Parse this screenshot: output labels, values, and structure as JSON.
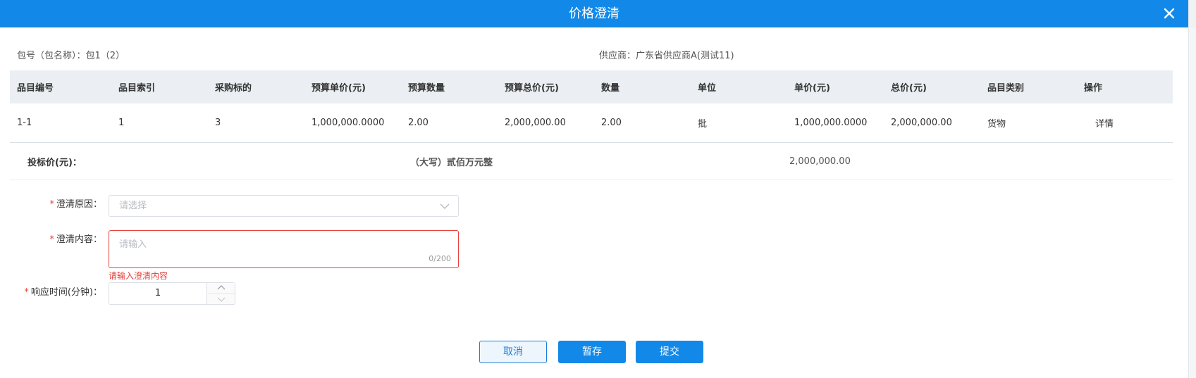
{
  "dialog": {
    "title": "价格澄清"
  },
  "package_info": {
    "label": "包号（包名称）：",
    "value": "包1（2）"
  },
  "supplier_info": {
    "label": "供应商：",
    "value": "广东省供应商A(测试11)"
  },
  "table": {
    "headers": [
      "品目编号",
      "品目索引",
      "采购标的",
      "预算单价(元)",
      "预算数量",
      "预算总价(元)",
      "数量",
      "单位",
      "单价(元)",
      "总价(元)",
      "品目类别",
      "操作"
    ],
    "rows": [
      {
        "cells": [
          "1-1",
          "1",
          "3",
          "1,000,000.0000",
          "2.00",
          "2,000,000.00",
          "2.00",
          "批",
          "1,000,000.0000",
          "2,000,000.00",
          "货物"
        ],
        "action": "详情"
      }
    ]
  },
  "summary": {
    "label": "投标价(元)：",
    "uppercase": "（大写）贰佰万元整",
    "amount": "2,000,000.00"
  },
  "form": {
    "reason": {
      "required_mark": "*",
      "label": "澄清原因：",
      "placeholder": "请选择"
    },
    "content": {
      "required_mark": "*",
      "label": "澄清内容：",
      "placeholder": "请输入",
      "counter": "0/200",
      "error": "请输入澄清内容"
    },
    "response_time": {
      "required_mark": "*",
      "label": "响应时间(分钟)：",
      "value": "1"
    }
  },
  "buttons": {
    "cancel": "取消",
    "save": "暂存",
    "submit": "提交"
  },
  "colors": {
    "primary": "#1289e8",
    "error": "#e5423d",
    "link": "#1f7fd8"
  }
}
